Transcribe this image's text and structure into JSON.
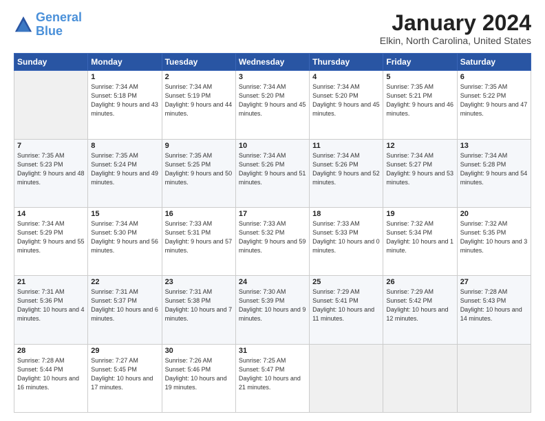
{
  "header": {
    "logo_line1": "General",
    "logo_line2": "Blue",
    "month_title": "January 2024",
    "location": "Elkin, North Carolina, United States"
  },
  "weekdays": [
    "Sunday",
    "Monday",
    "Tuesday",
    "Wednesday",
    "Thursday",
    "Friday",
    "Saturday"
  ],
  "weeks": [
    [
      {
        "day": "",
        "sunrise": "",
        "sunset": "",
        "daylight": ""
      },
      {
        "day": "1",
        "sunrise": "Sunrise: 7:34 AM",
        "sunset": "Sunset: 5:18 PM",
        "daylight": "Daylight: 9 hours and 43 minutes."
      },
      {
        "day": "2",
        "sunrise": "Sunrise: 7:34 AM",
        "sunset": "Sunset: 5:19 PM",
        "daylight": "Daylight: 9 hours and 44 minutes."
      },
      {
        "day": "3",
        "sunrise": "Sunrise: 7:34 AM",
        "sunset": "Sunset: 5:20 PM",
        "daylight": "Daylight: 9 hours and 45 minutes."
      },
      {
        "day": "4",
        "sunrise": "Sunrise: 7:34 AM",
        "sunset": "Sunset: 5:20 PM",
        "daylight": "Daylight: 9 hours and 45 minutes."
      },
      {
        "day": "5",
        "sunrise": "Sunrise: 7:35 AM",
        "sunset": "Sunset: 5:21 PM",
        "daylight": "Daylight: 9 hours and 46 minutes."
      },
      {
        "day": "6",
        "sunrise": "Sunrise: 7:35 AM",
        "sunset": "Sunset: 5:22 PM",
        "daylight": "Daylight: 9 hours and 47 minutes."
      }
    ],
    [
      {
        "day": "7",
        "sunrise": "Sunrise: 7:35 AM",
        "sunset": "Sunset: 5:23 PM",
        "daylight": "Daylight: 9 hours and 48 minutes."
      },
      {
        "day": "8",
        "sunrise": "Sunrise: 7:35 AM",
        "sunset": "Sunset: 5:24 PM",
        "daylight": "Daylight: 9 hours and 49 minutes."
      },
      {
        "day": "9",
        "sunrise": "Sunrise: 7:35 AM",
        "sunset": "Sunset: 5:25 PM",
        "daylight": "Daylight: 9 hours and 50 minutes."
      },
      {
        "day": "10",
        "sunrise": "Sunrise: 7:34 AM",
        "sunset": "Sunset: 5:26 PM",
        "daylight": "Daylight: 9 hours and 51 minutes."
      },
      {
        "day": "11",
        "sunrise": "Sunrise: 7:34 AM",
        "sunset": "Sunset: 5:26 PM",
        "daylight": "Daylight: 9 hours and 52 minutes."
      },
      {
        "day": "12",
        "sunrise": "Sunrise: 7:34 AM",
        "sunset": "Sunset: 5:27 PM",
        "daylight": "Daylight: 9 hours and 53 minutes."
      },
      {
        "day": "13",
        "sunrise": "Sunrise: 7:34 AM",
        "sunset": "Sunset: 5:28 PM",
        "daylight": "Daylight: 9 hours and 54 minutes."
      }
    ],
    [
      {
        "day": "14",
        "sunrise": "Sunrise: 7:34 AM",
        "sunset": "Sunset: 5:29 PM",
        "daylight": "Daylight: 9 hours and 55 minutes."
      },
      {
        "day": "15",
        "sunrise": "Sunrise: 7:34 AM",
        "sunset": "Sunset: 5:30 PM",
        "daylight": "Daylight: 9 hours and 56 minutes."
      },
      {
        "day": "16",
        "sunrise": "Sunrise: 7:33 AM",
        "sunset": "Sunset: 5:31 PM",
        "daylight": "Daylight: 9 hours and 57 minutes."
      },
      {
        "day": "17",
        "sunrise": "Sunrise: 7:33 AM",
        "sunset": "Sunset: 5:32 PM",
        "daylight": "Daylight: 9 hours and 59 minutes."
      },
      {
        "day": "18",
        "sunrise": "Sunrise: 7:33 AM",
        "sunset": "Sunset: 5:33 PM",
        "daylight": "Daylight: 10 hours and 0 minutes."
      },
      {
        "day": "19",
        "sunrise": "Sunrise: 7:32 AM",
        "sunset": "Sunset: 5:34 PM",
        "daylight": "Daylight: 10 hours and 1 minute."
      },
      {
        "day": "20",
        "sunrise": "Sunrise: 7:32 AM",
        "sunset": "Sunset: 5:35 PM",
        "daylight": "Daylight: 10 hours and 3 minutes."
      }
    ],
    [
      {
        "day": "21",
        "sunrise": "Sunrise: 7:31 AM",
        "sunset": "Sunset: 5:36 PM",
        "daylight": "Daylight: 10 hours and 4 minutes."
      },
      {
        "day": "22",
        "sunrise": "Sunrise: 7:31 AM",
        "sunset": "Sunset: 5:37 PM",
        "daylight": "Daylight: 10 hours and 6 minutes."
      },
      {
        "day": "23",
        "sunrise": "Sunrise: 7:31 AM",
        "sunset": "Sunset: 5:38 PM",
        "daylight": "Daylight: 10 hours and 7 minutes."
      },
      {
        "day": "24",
        "sunrise": "Sunrise: 7:30 AM",
        "sunset": "Sunset: 5:39 PM",
        "daylight": "Daylight: 10 hours and 9 minutes."
      },
      {
        "day": "25",
        "sunrise": "Sunrise: 7:29 AM",
        "sunset": "Sunset: 5:41 PM",
        "daylight": "Daylight: 10 hours and 11 minutes."
      },
      {
        "day": "26",
        "sunrise": "Sunrise: 7:29 AM",
        "sunset": "Sunset: 5:42 PM",
        "daylight": "Daylight: 10 hours and 12 minutes."
      },
      {
        "day": "27",
        "sunrise": "Sunrise: 7:28 AM",
        "sunset": "Sunset: 5:43 PM",
        "daylight": "Daylight: 10 hours and 14 minutes."
      }
    ],
    [
      {
        "day": "28",
        "sunrise": "Sunrise: 7:28 AM",
        "sunset": "Sunset: 5:44 PM",
        "daylight": "Daylight: 10 hours and 16 minutes."
      },
      {
        "day": "29",
        "sunrise": "Sunrise: 7:27 AM",
        "sunset": "Sunset: 5:45 PM",
        "daylight": "Daylight: 10 hours and 17 minutes."
      },
      {
        "day": "30",
        "sunrise": "Sunrise: 7:26 AM",
        "sunset": "Sunset: 5:46 PM",
        "daylight": "Daylight: 10 hours and 19 minutes."
      },
      {
        "day": "31",
        "sunrise": "Sunrise: 7:25 AM",
        "sunset": "Sunset: 5:47 PM",
        "daylight": "Daylight: 10 hours and 21 minutes."
      },
      {
        "day": "",
        "sunrise": "",
        "sunset": "",
        "daylight": ""
      },
      {
        "day": "",
        "sunrise": "",
        "sunset": "",
        "daylight": ""
      },
      {
        "day": "",
        "sunrise": "",
        "sunset": "",
        "daylight": ""
      }
    ]
  ]
}
